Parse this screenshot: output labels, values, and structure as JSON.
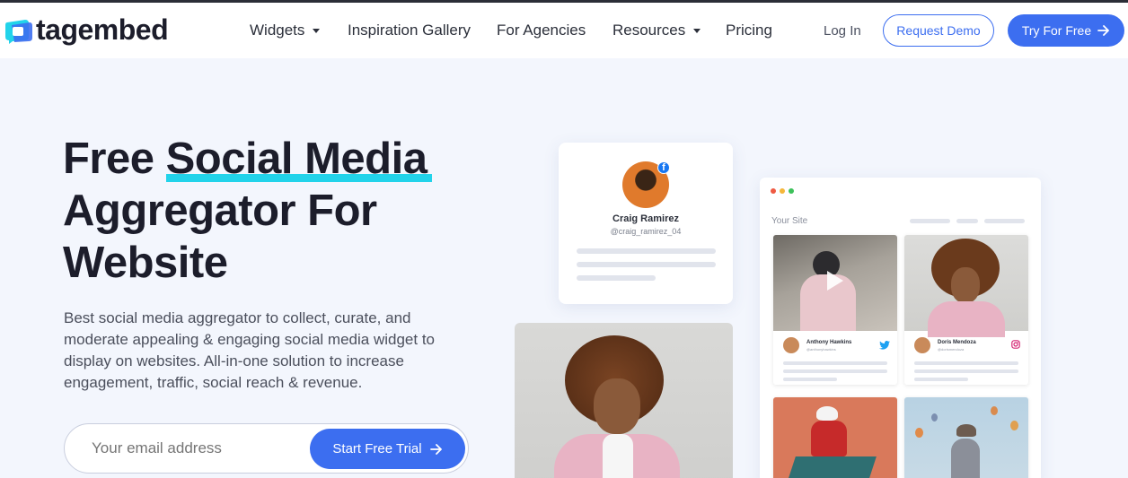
{
  "brand": {
    "name": "tagembed"
  },
  "nav": {
    "items": [
      {
        "label": "Widgets",
        "has_dropdown": true
      },
      {
        "label": "Inspiration Gallery",
        "has_dropdown": false
      },
      {
        "label": "For Agencies",
        "has_dropdown": false
      },
      {
        "label": "Resources",
        "has_dropdown": true
      },
      {
        "label": "Pricing",
        "has_dropdown": false
      }
    ],
    "login": "Log In",
    "request_demo": "Request Demo",
    "try_free": "Try For Free"
  },
  "hero": {
    "title_part1": "Free ",
    "title_highlight": "Social Media",
    "title_line2": "Aggregator For",
    "title_line3": "Website",
    "description": "Best social media aggregator to collect, curate, and moderate appealing & engaging social media widget to display on websites. All-in-one solution to increase engagement, traffic, social reach & revenue.",
    "email_placeholder": "Your email address",
    "cta_label": "Start Free Trial"
  },
  "profile_card": {
    "name": "Craig Ramirez",
    "handle": "@craig_ramirez_04",
    "network": "facebook"
  },
  "widget_preview": {
    "label": "Your Site",
    "posts": [
      {
        "name": "Anthony Hawkins",
        "handle": "@anthonyhawkins",
        "network": "twitter"
      },
      {
        "name": "Doris Mendoza",
        "handle": "@dorismendoza",
        "network": "instagram"
      }
    ]
  },
  "colors": {
    "accent": "#3c6ef0",
    "highlight": "#22d3ea",
    "background": "#f3f6fd"
  }
}
